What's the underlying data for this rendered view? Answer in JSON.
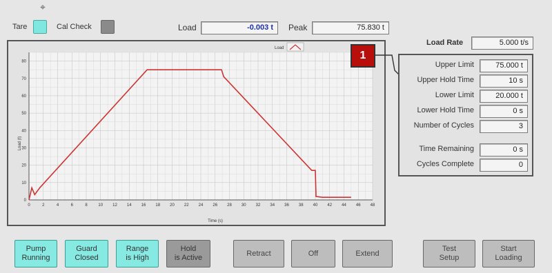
{
  "header": {
    "tare_label": "Tare",
    "cal_check_label": "Cal Check",
    "load_label": "Load",
    "load_value": "-0.003 t",
    "peak_label": "Peak",
    "peak_value": "75.830 t"
  },
  "badge_number": "1",
  "rate": {
    "label": "Load Rate",
    "value": "5.000 t/s"
  },
  "params": [
    {
      "label": "Upper Limit",
      "value": "75.000 t"
    },
    {
      "label": "Upper Hold Time",
      "value": "10 s"
    },
    {
      "label": "Lower Limit",
      "value": "20.000 t"
    },
    {
      "label": "Lower Hold Time",
      "value": "0 s"
    },
    {
      "label": "Number of Cycles",
      "value": "3"
    }
  ],
  "status": [
    {
      "label": "Time Remaining",
      "value": "0 s"
    },
    {
      "label": "Cycles Complete",
      "value": "0"
    }
  ],
  "buttons": {
    "pump": "Pump\nRunning",
    "guard": "Guard\nClosed",
    "range": "Range\nis High",
    "hold": "Hold\nis Active",
    "retract": "Retract",
    "off": "Off",
    "extend": "Extend",
    "test_setup": "Test\nSetup",
    "start_loading": "Start\nLoading"
  },
  "colors": {
    "indicator_on": "#7fe6e0",
    "line": "#cc3333",
    "badge": "#b80f0a"
  },
  "chart_data": {
    "type": "line",
    "legend": [
      "Load"
    ],
    "xlabel": "Time (s)",
    "ylabel": "Load (t)",
    "xlim": [
      0,
      48
    ],
    "ylim": [
      0,
      85
    ],
    "x_ticks": [
      "0",
      "2",
      "4",
      "6",
      "8",
      "10",
      "12",
      "14",
      "16",
      "18",
      "20",
      "22",
      "24",
      "26",
      "28",
      "30",
      "32",
      "34",
      "36",
      "38",
      "40",
      "42",
      "44",
      "46",
      "48"
    ],
    "y_ticks": [
      "0",
      "10",
      "20",
      "30",
      "40",
      "50",
      "60",
      "70",
      "80"
    ],
    "series": [
      {
        "name": "Load",
        "x": [
          0,
          0.4,
          0.8,
          1.5,
          16.5,
          26.9,
          27.2,
          39.5,
          40.0,
          40.1,
          41.0,
          45.0
        ],
        "y": [
          0,
          7,
          3,
          7,
          75,
          75,
          71,
          17,
          17,
          2,
          1.5,
          1.5
        ]
      }
    ]
  }
}
